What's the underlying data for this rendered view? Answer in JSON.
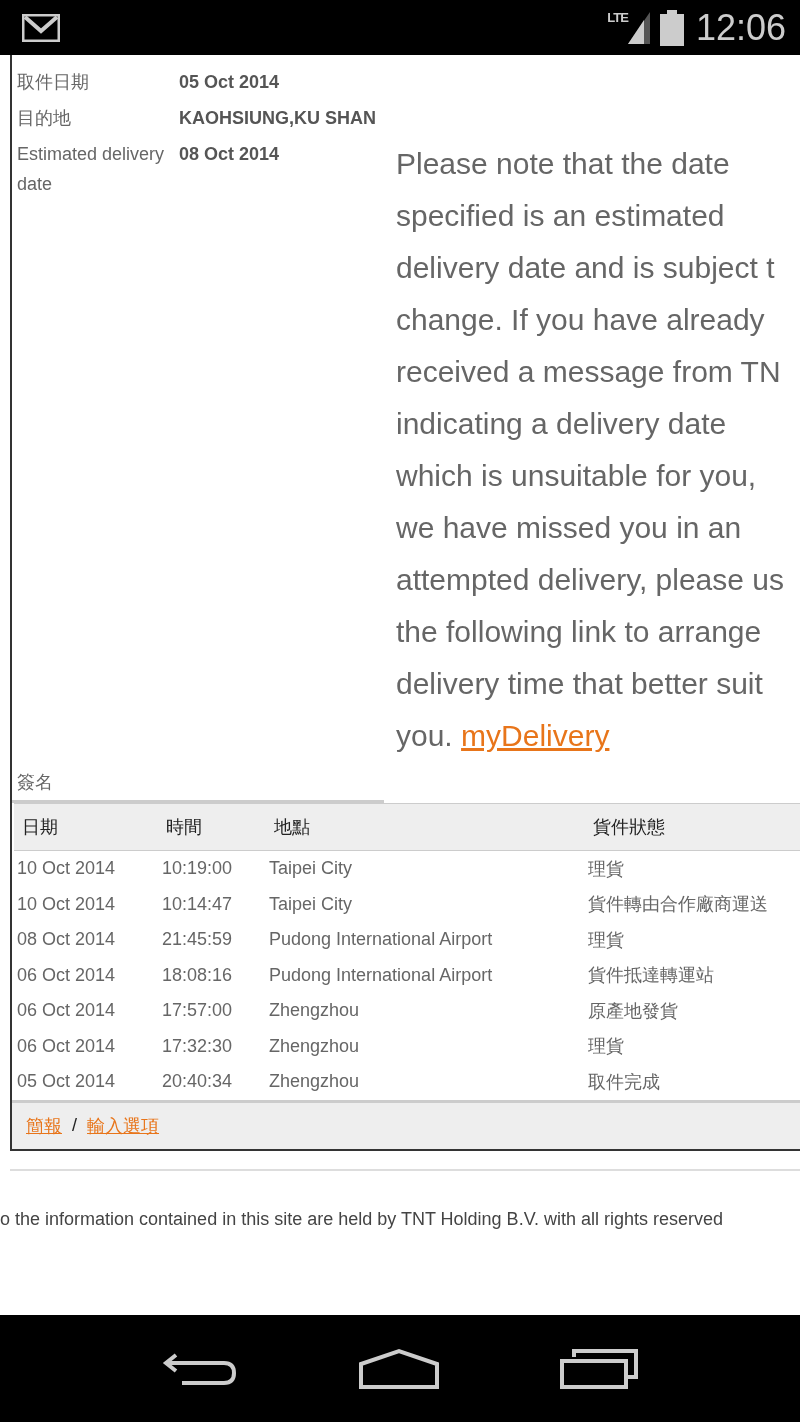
{
  "status_bar": {
    "time": "12:06",
    "network": "LTE"
  },
  "details": [
    {
      "label": "取件日期",
      "value": "05 Oct 2014"
    },
    {
      "label": "目的地",
      "value": "KAOHSIUNG,KU SHAN"
    },
    {
      "label": "Estimated delivery date",
      "value": "08 Oct 2014"
    }
  ],
  "note": {
    "lines": [
      "Please note that the date",
      "specified is an estimated",
      "delivery date and is subject t",
      "change. If you have already",
      "received a message from TN",
      "indicating a delivery date",
      "which is unsuitable for you,",
      "we have missed you in an",
      "attempted delivery, please us",
      "the following link to arrange",
      "delivery time that better suit",
      "you."
    ],
    "link": "myDelivery"
  },
  "signature_label": "簽名",
  "table": {
    "columns": [
      "日期",
      "時間",
      "地點",
      "貨件狀態"
    ],
    "rows": [
      [
        "10 Oct 2014",
        "10:19:00",
        "Taipei City",
        "理貨"
      ],
      [
        "10 Oct 2014",
        "10:14:47",
        "Taipei City",
        "貨件轉由合作廠商運送"
      ],
      [
        "08 Oct 2014",
        "21:45:59",
        "Pudong International Airport",
        "理貨"
      ],
      [
        "06 Oct 2014",
        "18:08:16",
        "Pudong International Airport",
        "貨件抵達轉運站"
      ],
      [
        "06 Oct 2014",
        "17:57:00",
        "Zhengzhou",
        "原產地發貨"
      ],
      [
        "06 Oct 2014",
        "17:32:30",
        "Zhengzhou",
        "理貨"
      ],
      [
        "05 Oct 2014",
        "20:40:34",
        "Zhengzhou",
        "取件完成"
      ]
    ]
  },
  "footer_links": [
    "簡報",
    "輸入選項"
  ],
  "footer_separator": "/",
  "copyright": "o the information contained in this site are held by TNT Holding B.V. with all rights reserved"
}
